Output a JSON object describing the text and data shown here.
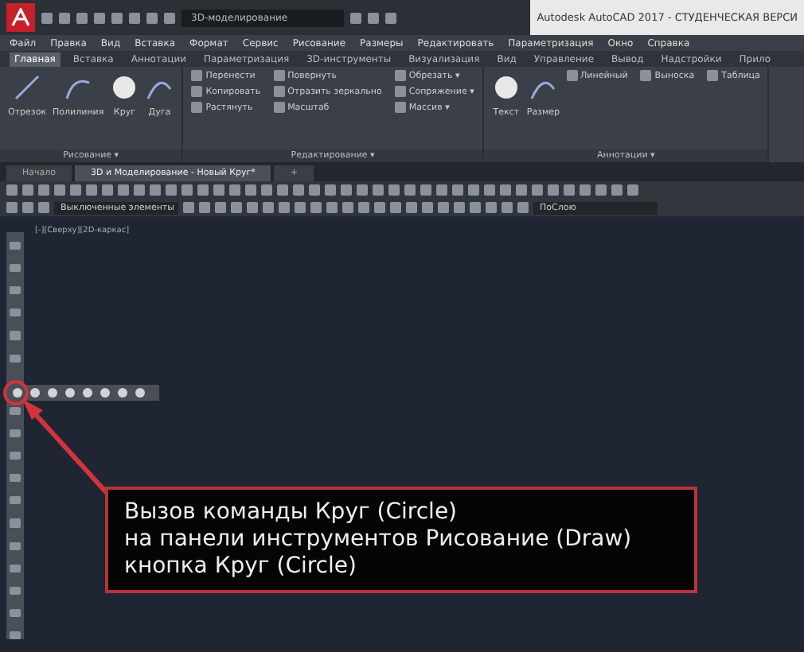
{
  "window": {
    "title": "Autodesk AutoCAD 2017 - СТУДЕНЧЕСКАЯ ВЕРСИ",
    "workspace": "3D-моделирование"
  },
  "menu": [
    "Файл",
    "Правка",
    "Вид",
    "Вставка",
    "Формат",
    "Сервис",
    "Рисование",
    "Размеры",
    "Редактировать",
    "Параметризация",
    "Окно",
    "Справка"
  ],
  "ribbon_tabs": [
    {
      "label": "Главная",
      "selected": true
    },
    {
      "label": "Вставка",
      "selected": false
    },
    {
      "label": "Аннотации",
      "selected": false
    },
    {
      "label": "Параметризация",
      "selected": false
    },
    {
      "label": "3D-инструменты",
      "selected": false
    },
    {
      "label": "Визуализация",
      "selected": false
    },
    {
      "label": "Вид",
      "selected": false
    },
    {
      "label": "Управление",
      "selected": false
    },
    {
      "label": "Вывод",
      "selected": false
    },
    {
      "label": "Надстройки",
      "selected": false
    },
    {
      "label": "Прило",
      "selected": false
    }
  ],
  "ribbon_panels": [
    {
      "label": "Рисование ▾",
      "tools": [
        {
          "kind": "big",
          "label": "Отрезок"
        },
        {
          "kind": "big",
          "label": "Полилиния"
        },
        {
          "kind": "big",
          "label": "Круг"
        },
        {
          "kind": "big",
          "label": "Дуга"
        }
      ]
    },
    {
      "label": "Редактирование ▾",
      "tools": [
        {
          "kind": "small",
          "label": "Перенести"
        },
        {
          "kind": "small",
          "label": "Повернуть"
        },
        {
          "kind": "small",
          "label": "Обрезать ▾"
        },
        {
          "kind": "small",
          "label": "Копировать"
        },
        {
          "kind": "small",
          "label": "Отразить зеркально"
        },
        {
          "kind": "small",
          "label": "Сопряжение ▾"
        },
        {
          "kind": "small",
          "label": "Растянуть"
        },
        {
          "kind": "small",
          "label": "Масштаб"
        },
        {
          "kind": "small",
          "label": "Массив ▾"
        }
      ]
    },
    {
      "label": "Аннотации ▾",
      "tools": [
        {
          "kind": "big",
          "label": "Текст"
        },
        {
          "kind": "big",
          "label": "Размер"
        },
        {
          "kind": "small",
          "label": "Линейный"
        },
        {
          "kind": "small",
          "label": "Выноска"
        },
        {
          "kind": "small",
          "label": "Таблица"
        }
      ]
    }
  ],
  "file_tabs": [
    {
      "label": "Начало",
      "selected": false
    },
    {
      "label": "3D и Моделирование - Новый Круг*",
      "selected": true
    },
    {
      "label": "+",
      "selected": false
    }
  ],
  "layer_dropdown": "Выключенные элементы",
  "color_dropdown": "ПоСлою",
  "viewport_label": "[-][Сверху][2D-каркас]",
  "callout": "Вызов команды Круг (Circle)\nна панели инструментов Рисование (Draw)\nкнопка Круг (Circle)"
}
